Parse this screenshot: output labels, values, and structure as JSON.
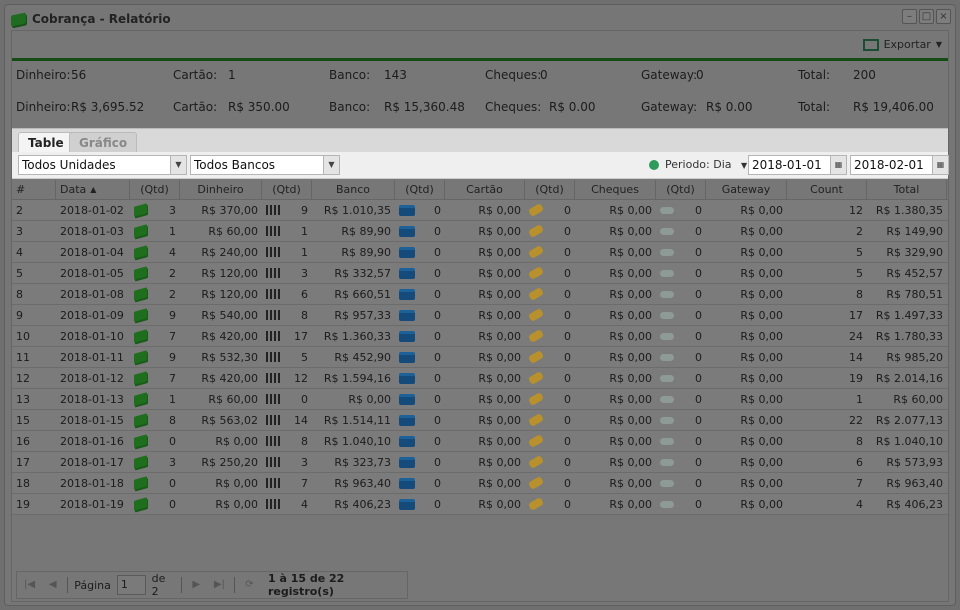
{
  "window": {
    "title": "Cobrança - Relatório",
    "icon": "money-icon"
  },
  "toolbar": {
    "export_label": "Exportar"
  },
  "summary": {
    "counts": [
      {
        "label": "Dinheiro:",
        "value": "56"
      },
      {
        "label": "Cartão:",
        "value": "1"
      },
      {
        "label": "Banco:",
        "value": "143"
      },
      {
        "label": "Cheques:",
        "value": "0"
      },
      {
        "label": "Gateway:",
        "value": "0"
      },
      {
        "label": "Total:",
        "value": "200"
      }
    ],
    "amounts": [
      {
        "label": "Dinheiro:",
        "value": "R$ 3,695.52"
      },
      {
        "label": "Cartão:",
        "value": "R$ 350.00"
      },
      {
        "label": "Banco:",
        "value": "R$ 15,360.48"
      },
      {
        "label": "Cheques:",
        "value": "R$ 0.00"
      },
      {
        "label": "Gateway:",
        "value": "R$ 0.00"
      },
      {
        "label": "Total:",
        "value": "R$ 19,406.00"
      }
    ]
  },
  "tabs": [
    {
      "label": "Table",
      "active": true
    },
    {
      "label": "Gráfico",
      "active": false
    }
  ],
  "filters": {
    "unidade": "Todos Unidades",
    "banco": "Todos Bancos",
    "periodo": "Periodo: Dia",
    "date_from": "2018-01-01",
    "date_to": "2018-02-01",
    "status_color": "#2e9a5c"
  },
  "table": {
    "columns": [
      "#",
      "Data",
      "(Qtd)",
      "Dinheiro",
      "(Qtd)",
      "Banco",
      "(Qtd)",
      "Cartão",
      "(Qtd)",
      "Cheques",
      "(Qtd)",
      "Gateway",
      "Count",
      "Total"
    ],
    "rows": [
      [
        "2",
        "2018-01-02",
        "3",
        "R$ 370,00",
        "9",
        "R$ 1.010,35",
        "0",
        "R$ 0,00",
        "0",
        "R$ 0,00",
        "0",
        "R$ 0,00",
        "12",
        "R$ 1.380,35"
      ],
      [
        "3",
        "2018-01-03",
        "1",
        "R$ 60,00",
        "1",
        "R$ 89,90",
        "0",
        "R$ 0,00",
        "0",
        "R$ 0,00",
        "0",
        "R$ 0,00",
        "2",
        "R$ 149,90"
      ],
      [
        "4",
        "2018-01-04",
        "4",
        "R$ 240,00",
        "1",
        "R$ 89,90",
        "0",
        "R$ 0,00",
        "0",
        "R$ 0,00",
        "0",
        "R$ 0,00",
        "5",
        "R$ 329,90"
      ],
      [
        "5",
        "2018-01-05",
        "2",
        "R$ 120,00",
        "3",
        "R$ 332,57",
        "0",
        "R$ 0,00",
        "0",
        "R$ 0,00",
        "0",
        "R$ 0,00",
        "5",
        "R$ 452,57"
      ],
      [
        "8",
        "2018-01-08",
        "2",
        "R$ 120,00",
        "6",
        "R$ 660,51",
        "0",
        "R$ 0,00",
        "0",
        "R$ 0,00",
        "0",
        "R$ 0,00",
        "8",
        "R$ 780,51"
      ],
      [
        "9",
        "2018-01-09",
        "9",
        "R$ 540,00",
        "8",
        "R$ 957,33",
        "0",
        "R$ 0,00",
        "0",
        "R$ 0,00",
        "0",
        "R$ 0,00",
        "17",
        "R$ 1.497,33"
      ],
      [
        "10",
        "2018-01-10",
        "7",
        "R$ 420,00",
        "17",
        "R$ 1.360,33",
        "0",
        "R$ 0,00",
        "0",
        "R$ 0,00",
        "0",
        "R$ 0,00",
        "24",
        "R$ 1.780,33"
      ],
      [
        "11",
        "2018-01-11",
        "9",
        "R$ 532,30",
        "5",
        "R$ 452,90",
        "0",
        "R$ 0,00",
        "0",
        "R$ 0,00",
        "0",
        "R$ 0,00",
        "14",
        "R$ 985,20"
      ],
      [
        "12",
        "2018-01-12",
        "7",
        "R$ 420,00",
        "12",
        "R$ 1.594,16",
        "0",
        "R$ 0,00",
        "0",
        "R$ 0,00",
        "0",
        "R$ 0,00",
        "19",
        "R$ 2.014,16"
      ],
      [
        "13",
        "2018-01-13",
        "1",
        "R$ 60,00",
        "0",
        "R$ 0,00",
        "0",
        "R$ 0,00",
        "0",
        "R$ 0,00",
        "0",
        "R$ 0,00",
        "1",
        "R$ 60,00"
      ],
      [
        "15",
        "2018-01-15",
        "8",
        "R$ 563,02",
        "14",
        "R$ 1.514,11",
        "0",
        "R$ 0,00",
        "0",
        "R$ 0,00",
        "0",
        "R$ 0,00",
        "22",
        "R$ 2.077,13"
      ],
      [
        "16",
        "2018-01-16",
        "0",
        "R$ 0,00",
        "8",
        "R$ 1.040,10",
        "0",
        "R$ 0,00",
        "0",
        "R$ 0,00",
        "0",
        "R$ 0,00",
        "8",
        "R$ 1.040,10"
      ],
      [
        "17",
        "2018-01-17",
        "3",
        "R$ 250,20",
        "3",
        "R$ 323,73",
        "0",
        "R$ 0,00",
        "0",
        "R$ 0,00",
        "0",
        "R$ 0,00",
        "6",
        "R$ 573,93"
      ],
      [
        "18",
        "2018-01-18",
        "0",
        "R$ 0,00",
        "7",
        "R$ 963,40",
        "0",
        "R$ 0,00",
        "0",
        "R$ 0,00",
        "0",
        "R$ 0,00",
        "7",
        "R$ 963,40"
      ],
      [
        "19",
        "2018-01-19",
        "0",
        "R$ 0,00",
        "4",
        "R$ 406,23",
        "0",
        "R$ 0,00",
        "0",
        "R$ 0,00",
        "0",
        "R$ 0,00",
        "4",
        "R$ 406,23"
      ]
    ]
  },
  "pager": {
    "page_label": "Página",
    "page": "1",
    "of_label": "de 2",
    "info": "1 à 15 de 22 registro(s)"
  }
}
